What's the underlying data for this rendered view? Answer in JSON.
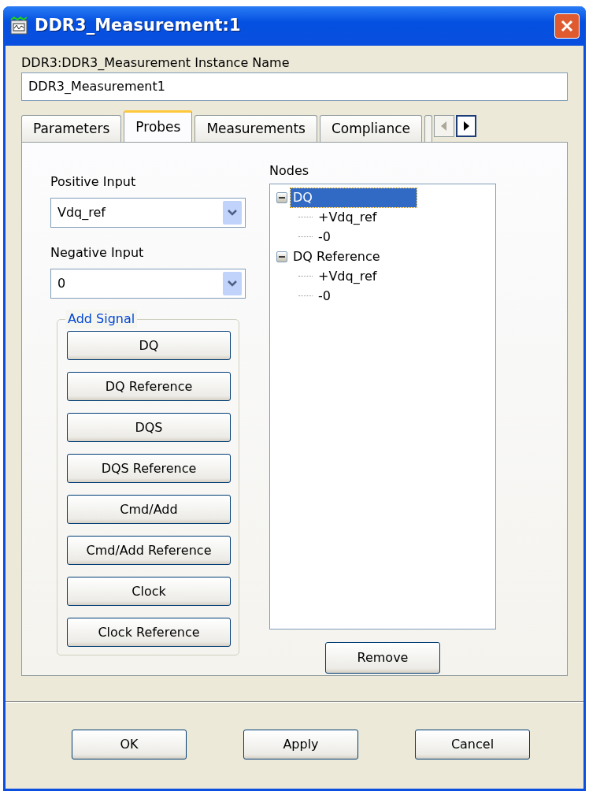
{
  "window": {
    "title": "DDR3_Measurement:1"
  },
  "instance": {
    "label": "DDR3:DDR3_Measurement Instance Name",
    "value": "DDR3_Measurement1"
  },
  "tabs": [
    {
      "label": "Parameters",
      "selected": false
    },
    {
      "label": "Probes",
      "selected": true
    },
    {
      "label": "Measurements",
      "selected": false
    },
    {
      "label": "Compliance",
      "selected": false
    }
  ],
  "tab_scroll": {
    "left_disabled": true,
    "right_disabled": false
  },
  "positive_input": {
    "label": "Positive Input",
    "value": "Vdq_ref"
  },
  "negative_input": {
    "label": "Negative Input",
    "value": "0"
  },
  "add_signal": {
    "title": "Add Signal",
    "buttons": [
      "DQ",
      "DQ Reference",
      "DQS",
      "DQS Reference",
      "Cmd/Add",
      "Cmd/Add Reference",
      "Clock",
      "Clock Reference"
    ]
  },
  "nodes": {
    "label": "Nodes",
    "items": [
      {
        "label": "DQ",
        "selected": true,
        "expanded": true,
        "children": [
          {
            "label": "+Vdq_ref",
            "selected": false
          },
          {
            "label": "-0",
            "selected": false
          }
        ]
      },
      {
        "label": "DQ Reference",
        "selected": false,
        "expanded": true,
        "children": [
          {
            "label": "+Vdq_ref",
            "selected": false
          },
          {
            "label": "-0",
            "selected": false
          }
        ]
      }
    ]
  },
  "remove_button": "Remove",
  "buttons": [
    "OK",
    "Apply",
    "Cancel"
  ]
}
